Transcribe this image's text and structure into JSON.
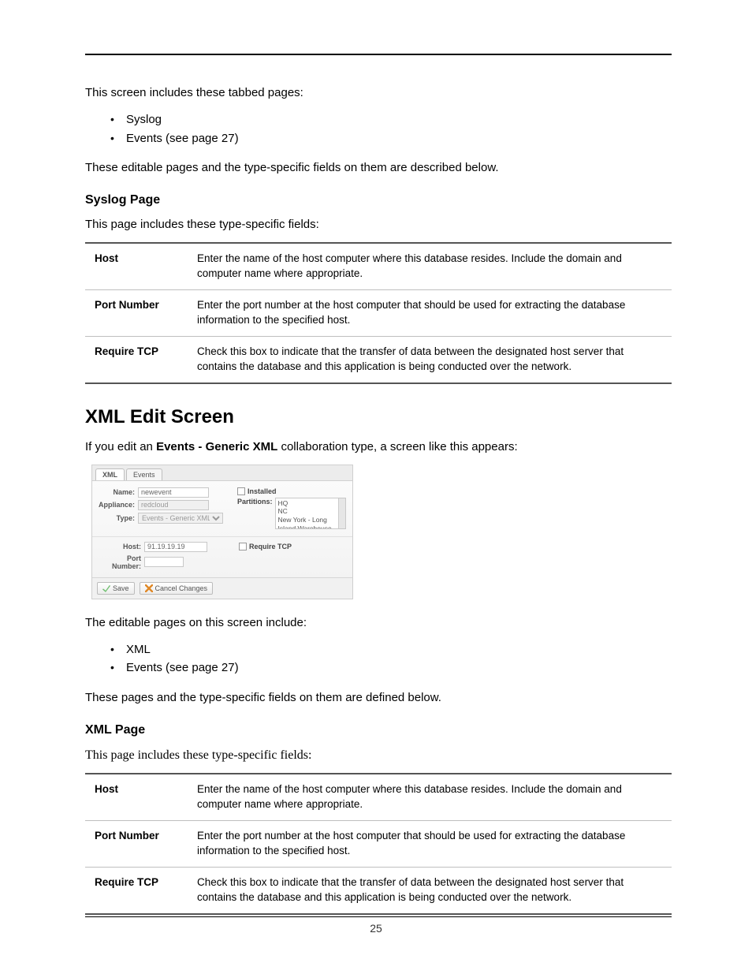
{
  "intro1": "This screen includes these tabbed pages:",
  "bullets1": {
    "a": "Syslog",
    "b": "Events (see page 27)"
  },
  "intro1b": "These editable pages and the type-specific fields on them are described below.",
  "syslog_heading": "Syslog Page",
  "syslog_intro": "This page includes these type-specific fields:",
  "table1": {
    "r1k": "Host",
    "r1v": "Enter the name of the host computer where this database resides. Include the domain and computer name where appropriate.",
    "r2k": "Port Number",
    "r2v": "Enter the port number at the host computer that should be used for extracting the database information to the specified host.",
    "r3k": "Require TCP",
    "r3v": "Check this box to indicate that the transfer of data between the designated host server that contains the database and this application is being conducted over the network."
  },
  "xml_heading": "XML Edit Screen",
  "xml_intro_pre": "If you edit an ",
  "xml_intro_bold": "Events - Generic XML",
  "xml_intro_post": " collaboration type, a screen like this appears:",
  "shot": {
    "tab_xml": "XML",
    "tab_events": "Events",
    "lbl_name": "Name:",
    "val_name": "newevent",
    "lbl_appliance": "Appliance:",
    "val_appliance": "redcloud",
    "lbl_type": "Type:",
    "val_type": "Events - Generic XML",
    "lbl_installed": "Installed",
    "lbl_partitions": "Partitions:",
    "p1": "HQ",
    "p2": "NC",
    "p3": "New York - Long Island Warehouse",
    "lbl_host": "Host:",
    "val_host": "91.19.19.19",
    "lbl_reqtcp": "Require TCP",
    "lbl_port": "Port Number:",
    "btn_save": "Save",
    "btn_cancel": "Cancel Changes"
  },
  "xml_after": "The editable pages on this screen include:",
  "bullets2": {
    "a": "XML",
    "b": "Events (see page 27)"
  },
  "xml_after2": "These pages and the type-specific fields on them are defined below.",
  "xml_page_heading": "XML Page",
  "xml_page_intro": "This page includes these type-specific fields:",
  "table2": {
    "r1k": "Host",
    "r1v": "Enter the name of the host computer where this database resides. Include the domain and computer name where appropriate.",
    "r2k": "Port Number",
    "r2v": "Enter the port number at the host computer that should be used for extracting the database information to the specified host.",
    "r3k": "Require TCP",
    "r3v": "Check this box to indicate that the transfer of data between the designated host server that contains the database and this application is being conducted over the network."
  },
  "page_number": "25"
}
